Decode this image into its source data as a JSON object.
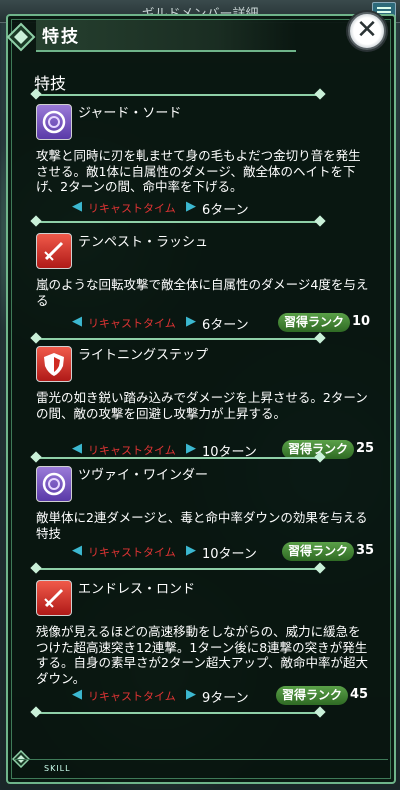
{
  "top_bar": {
    "title": "ギルドメンバー詳細"
  },
  "panel": {
    "header_title": "特技",
    "section_title": "特技",
    "footer_label": "SKILL"
  },
  "recast_label": "リキャストタイム",
  "rank_label": "習得ランク",
  "skills": [
    {
      "name": "ジャード・ソード",
      "icon": "purple-swirl-icon",
      "description": "攻撃と同時に刃を軋ませて身の毛もよだつ金切り音を発生させる。敵1体に自属性のダメージ、敵全体のヘイトを下げ、2ターンの間、命中率を下げる。",
      "recast": "6ターン",
      "rank": ""
    },
    {
      "name": "テンペスト・ラッシュ",
      "icon": "red-sword-icon",
      "description": "嵐のような回転攻撃で敵全体に自属性のダメージ4度を与える",
      "recast": "6ターン",
      "rank": "10"
    },
    {
      "name": "ライトニングステップ",
      "icon": "red-shield-icon",
      "description": "雷光の如き鋭い踏み込みでダメージを上昇させる。2ターンの間、敵の攻撃を回避し攻撃力が上昇する。",
      "recast": "10ターン",
      "rank": "25"
    },
    {
      "name": "ツヴァイ・ワインダー",
      "icon": "purple-swirl-icon",
      "description": "敵単体に2連ダメージと、毒と命中率ダウンの効果を与える特技",
      "recast": "10ターン",
      "rank": "35"
    },
    {
      "name": "エンドレス・ロンド",
      "icon": "red-sword-icon",
      "description": "残像が見えるほどの高速移動をしながらの、威力に緩急をつけた超高速突き12連撃。1ターン後に8連撃の突きが発生する。自身の素早さが2ターン超大アップ、敵命中率が超大ダウン。",
      "recast": "9ターン",
      "rank": "45"
    }
  ],
  "colors": {
    "accent": "#6fb48a",
    "recast_red": "#e03434",
    "rank_green": "#4a8f3c"
  }
}
